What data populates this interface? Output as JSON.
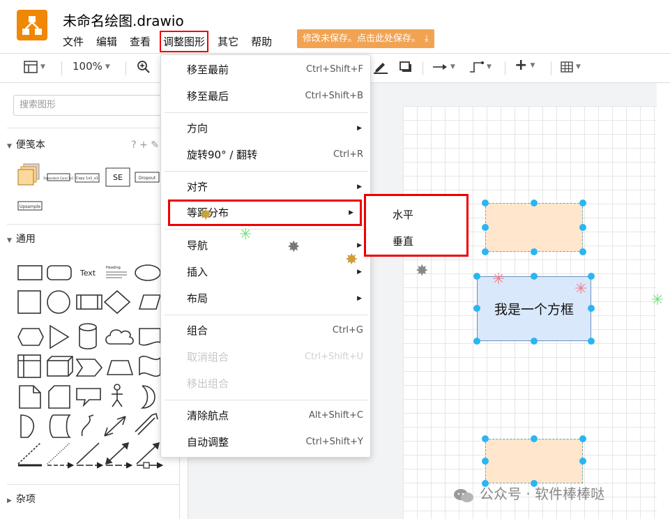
{
  "app": {
    "title": "未命名绘图.drawio",
    "logo": "drawio-logo-icon",
    "accent": "#f08705"
  },
  "menubar": {
    "items": [
      "文件",
      "编辑",
      "查看",
      "调整图形",
      "其它",
      "帮助"
    ],
    "active_index": 3
  },
  "save_notice": {
    "text": "修改未保存。点击此处保存。",
    "icon": "download-icon",
    "color": "#f2a352"
  },
  "toolbar": {
    "zoom": "100%"
  },
  "sidebar": {
    "search_placeholder": "搜索图形",
    "sections": {
      "scratchpad": "便笺本",
      "general": "通用",
      "misc": "杂项"
    },
    "scratchpad_tools": "? + ✎",
    "scratch_items": [
      "Dependent Consi 1x1",
      "Copy 1x1_x1",
      "SE",
      "Dropout",
      "Upsample"
    ],
    "general_text_shape": "Text",
    "general_heading_shape": "Heading"
  },
  "dropdown": {
    "items": [
      {
        "label": "移至最前",
        "shortcut": "Ctrl+Shift+F"
      },
      {
        "label": "移至最后",
        "shortcut": "Ctrl+Shift+B"
      },
      {
        "label": "方向",
        "submenu": true
      },
      {
        "label": "旋转90° / 翻转",
        "shortcut": "Ctrl+R"
      },
      {
        "label": "对齐",
        "submenu": true
      },
      {
        "label": "等距分布",
        "submenu": true,
        "highlighted": true
      },
      {
        "label": "导航",
        "submenu": true
      },
      {
        "label": "插入",
        "submenu": true
      },
      {
        "label": "布局",
        "submenu": true
      },
      {
        "label": "组合",
        "shortcut": "Ctrl+G"
      },
      {
        "label": "取消组合",
        "shortcut": "Ctrl+Shift+U",
        "disabled": true
      },
      {
        "label": "移出组合",
        "disabled": true
      },
      {
        "label": "清除航点",
        "shortcut": "Alt+Shift+C"
      },
      {
        "label": "自动调整",
        "shortcut": "Ctrl+Shift+Y"
      }
    ]
  },
  "submenu": {
    "items": [
      "水平",
      "垂直"
    ]
  },
  "canvas": {
    "center_box_text": "我是一个方框",
    "peach_color": "#ffe6cc",
    "blue_color": "#dae8fc",
    "handle_color": "#29b6f2"
  },
  "watermark": {
    "text": "公众号 · 软件棒棒哒",
    "icon": "wechat-icon"
  }
}
